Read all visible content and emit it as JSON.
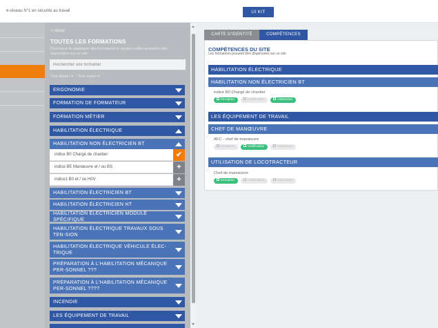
{
  "topbar": {
    "tagline": "e-réseau N°1 en sécurité au travail",
    "button": "UI KIT"
  },
  "catalog": {
    "back": "< retour",
    "title": "TOUTES LES FORMATIONS",
    "description": "Parcourez le catalogue des formations et ajoutez celles assurées être disponibles sur ce site",
    "search_placeholder": "Rechercher une formation",
    "sort_links": [
      "Tout déplier ▾",
      "Tout replier ▾"
    ],
    "categories": [
      {
        "label": "ERGONOMIE",
        "state": "closed"
      },
      {
        "label": "FORMATION DE FORMATEUR",
        "state": "closed"
      },
      {
        "label": "FORMATION MÉTIER",
        "state": "closed"
      },
      {
        "label": "HABILITATION ÉLECTRIQUE",
        "state": "open"
      },
      {
        "label": "HABILITATION NON ÉLECTRICIEN BT",
        "state": "open",
        "sub": true
      },
      {
        "label": "HABILITATION ÉLECTRICIEN BT",
        "state": "closed",
        "sub": true
      },
      {
        "label": "HABILITATION ÉLECTRICIEN HT",
        "state": "closed",
        "sub": true
      },
      {
        "label": "HABILITATION ÉLECTRICIEN MODULE SPÉCIFIQUE",
        "state": "closed",
        "sub": true
      },
      {
        "label": "HABILITATION ÉLECTRIQUE TRAVAUX SOUS TEN-SION",
        "state": "closed",
        "sub": true
      },
      {
        "label": "HABILITATION ÉLECTRIQUE VÉHICULE ÉLEC-TRIQUE",
        "state": "closed",
        "sub": true
      },
      {
        "label": "PRÉPARATION À L'HABILITATION MÉCANIQUE PER-SONNEL ???",
        "state": "closed",
        "sub": true
      },
      {
        "label": "PRÉPARATION À L'HABILITATION MÉCANIQUE PER-SONNEL ????",
        "state": "closed",
        "sub": true
      },
      {
        "label": "INCENDIE",
        "state": "closed"
      },
      {
        "label": "LES ÉQUIPEMENT DE TRAVAIL",
        "state": "closed"
      }
    ],
    "subitems": [
      {
        "label": "indice B0 Chargé de chantier",
        "selected": true,
        "icon": "✔"
      },
      {
        "label": "indice BE Manœuvre et / ou BS",
        "selected": false,
        "icon": "+"
      },
      {
        "label": "indice1 B0 et / ou H0V",
        "selected": false,
        "icon": "+"
      }
    ]
  },
  "tabs": [
    {
      "label": "CARTE D'IDENTITÉ",
      "active": false
    },
    {
      "label": "COMPÉTENCES",
      "active": true
    }
  ],
  "competences": {
    "title": "COMPÉTENCES DU SITE",
    "subtitle": "Les formations pouvant être dispensées sur ce site",
    "headers": [
      "HABILITATION ÉLECTRIQUE",
      "HABILITATION NON ÉLECTRICIEN BT",
      "LES ÉQUIPEMENT DE TRAVAIL",
      "CHEF DE MANŒUVRE",
      "UTILISATION DE LOCOTRACTEUR"
    ],
    "items": [
      {
        "name": "indice B0 Chargé de chantier",
        "badges": [
          {
            "label": "formation",
            "on": true
          },
          {
            "label": "certification",
            "on": false
          },
          {
            "label": "instruction",
            "on": true
          }
        ]
      },
      {
        "name": "AFC - chef de manœuvre",
        "badges": [
          {
            "label": "formation",
            "on": false
          },
          {
            "label": "certification",
            "on": true
          },
          {
            "label": "instruction",
            "on": false
          }
        ]
      },
      {
        "name": "Chef de manœuvre",
        "badges": [
          {
            "label": "formation",
            "on": true
          },
          {
            "label": "certification",
            "on": false
          },
          {
            "label": "instruction",
            "on": false
          }
        ]
      }
    ]
  },
  "colors": {
    "primary": "#2f57a3",
    "secondary": "#4b73b8",
    "accent": "#ef7d0b",
    "badge_on": "#3bbf7c"
  }
}
